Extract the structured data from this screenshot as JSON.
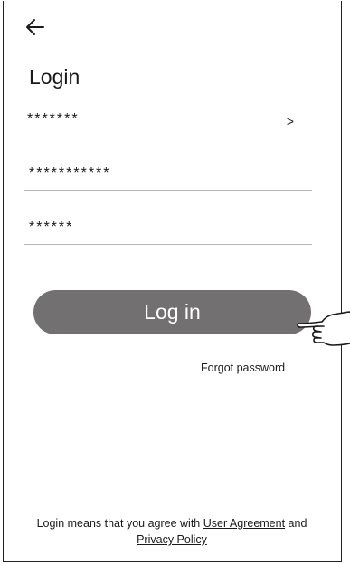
{
  "header": {
    "back_icon": "arrow-left-icon"
  },
  "title": "Login",
  "fields": {
    "account": {
      "value": "*******",
      "chevron": ">"
    },
    "password": {
      "value": "***********"
    },
    "code": {
      "value": "******"
    }
  },
  "login_button_label": "Log in",
  "hand_icon": "pointing-hand-icon",
  "forgot_password": "Forgot password",
  "agreement": {
    "prefix": "Login means that you agree with ",
    "user_agreement": "User Agreement",
    "and": " and",
    "privacy_policy": "Privacy Policy"
  }
}
